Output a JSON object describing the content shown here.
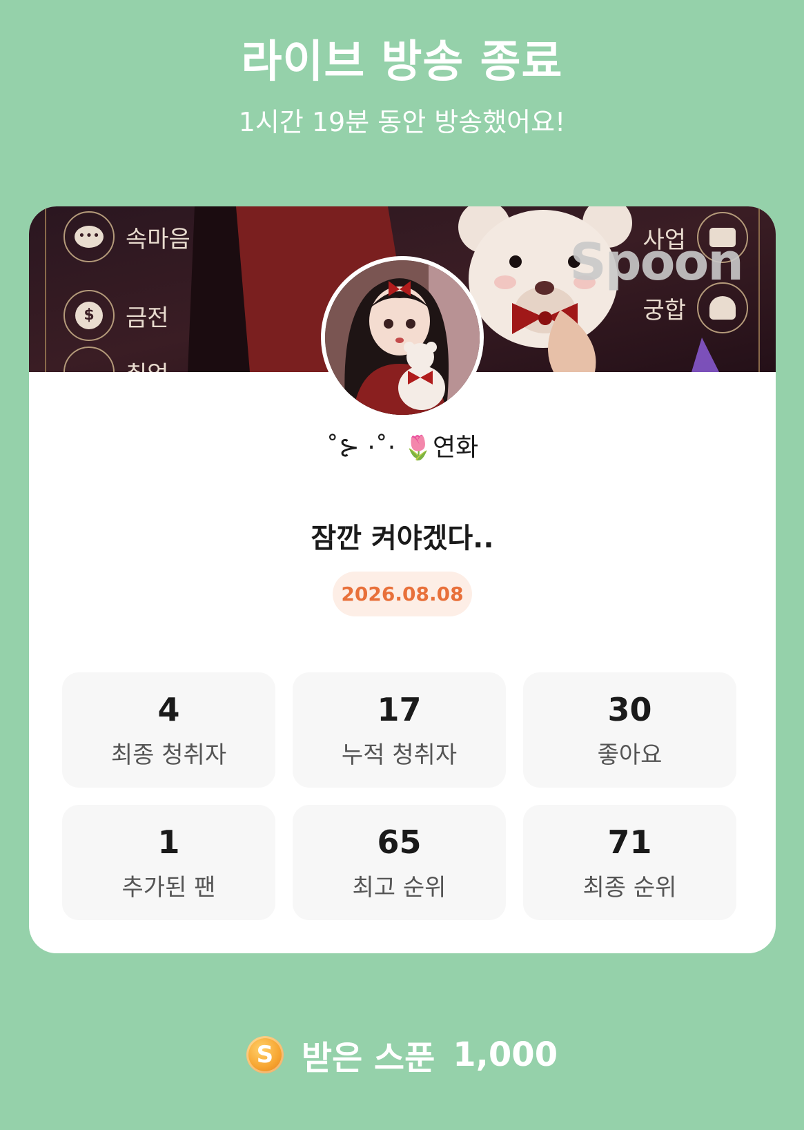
{
  "header": {
    "title": "라이브 방송 종료",
    "subtitle": "1시간 19분 동안 방송했어요!"
  },
  "banner": {
    "watermark": "Spoon",
    "menu_left": [
      "속마음",
      "금전",
      "취업"
    ],
    "menu_right": [
      "사업",
      "궁합"
    ],
    "icons_left": [
      "speech-bubble-icon",
      "money-bag-icon",
      "graduation-cap-icon"
    ],
    "icons_right": [
      "briefcase-icon",
      "people-icon"
    ]
  },
  "profile": {
    "nickname_prefix": "˚⊱ ·˚·",
    "nickname_emoji": "🌷",
    "nickname_name": "연화"
  },
  "live": {
    "title": "잠깐 켜야겠다..",
    "date": "2026.08.08"
  },
  "stats": [
    {
      "value": "4",
      "label": "최종 청취자"
    },
    {
      "value": "17",
      "label": "누적 청취자"
    },
    {
      "value": "30",
      "label": "좋아요"
    },
    {
      "value": "1",
      "label": "추가된 팬"
    },
    {
      "value": "65",
      "label": "최고 순위"
    },
    {
      "value": "71",
      "label": "최종 순위"
    }
  ],
  "spoons": {
    "coin_symbol": "S",
    "label": "받은 스푼",
    "value": "1,000"
  },
  "colors": {
    "background": "#95d1aa",
    "card": "#ffffff",
    "stat_box": "#f7f7f7",
    "date_badge_bg": "#fdeee6",
    "date_badge_text": "#e8703a",
    "coin": "#f7a531"
  }
}
